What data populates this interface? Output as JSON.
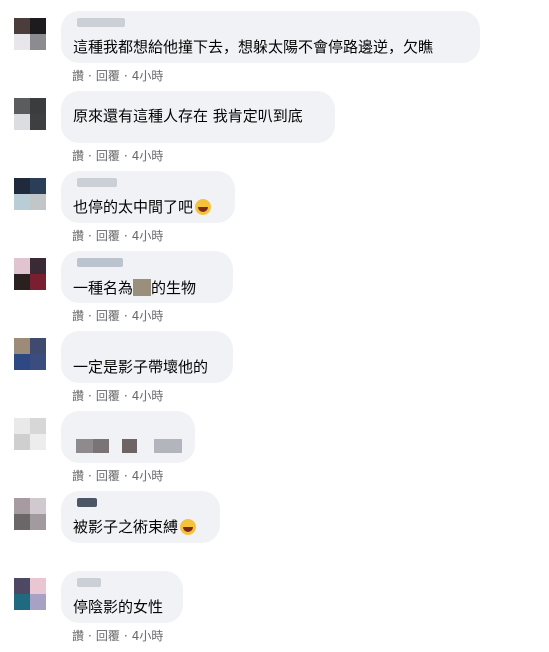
{
  "comments": [
    {
      "text": "這種我都想給他撞下去，想躲太陽不會停路邊逆，欠瞧",
      "meta": {
        "like": "讚",
        "reply": "回覆",
        "time": "4小時"
      },
      "avatar": [
        "#4a3d3b",
        "#1d1b1e",
        "#e8e6ea",
        "#8c8b90"
      ]
    },
    {
      "text": "原來還有這種人存在 我肯定叭到底",
      "meta": {
        "like": "讚",
        "reply": "回覆",
        "time": "4小時"
      },
      "avatar": [
        "#5a5c5e",
        "#3a3c3e",
        "#dcdde0",
        "#3e3f41"
      ]
    },
    {
      "text": "也停的太中間了吧",
      "meta": {
        "like": "讚",
        "reply": "回覆",
        "time": "4小時"
      },
      "avatar": [
        "#1f2b3d",
        "#2a3e57",
        "#b9cdd6",
        "#c3c6c9"
      ]
    },
    {
      "text": "一種名為",
      "text2": "的生物",
      "meta": {
        "like": "讚",
        "reply": "回覆",
        "time": "4小時"
      },
      "avatar": [
        "#e0c4cf",
        "#3a2a35",
        "#2b2020",
        "#7a1f2f"
      ]
    },
    {
      "text": "一定是影子帶壞他的",
      "meta": {
        "like": "讚",
        "reply": "回覆",
        "time": "4小時"
      },
      "avatar": [
        "#9b8b78",
        "#3e4a6e",
        "#2e4883",
        "#3b4d7e"
      ]
    },
    {
      "text": "",
      "meta": {
        "like": "讚",
        "reply": "回覆",
        "time": "4小時"
      },
      "avatar": [
        "#e9e9e9",
        "#d7d7d7",
        "#cfcfcf",
        "#ededed"
      ]
    },
    {
      "text": "被影子之術束縛",
      "meta": {
        "like": "讚",
        "reply": "回覆",
        "time": "4小時"
      },
      "avatar": [
        "#a79aa1",
        "#d0c9cf",
        "#6b6668",
        "#a29a9f"
      ]
    },
    {
      "text": "停陰影的女性",
      "meta": {
        "like": "讚",
        "reply": "回覆",
        "time": "4小時"
      },
      "avatar": [
        "#4f4865",
        "#e9c6d2",
        "#1f6a7f",
        "#a8a1c6"
      ]
    }
  ]
}
